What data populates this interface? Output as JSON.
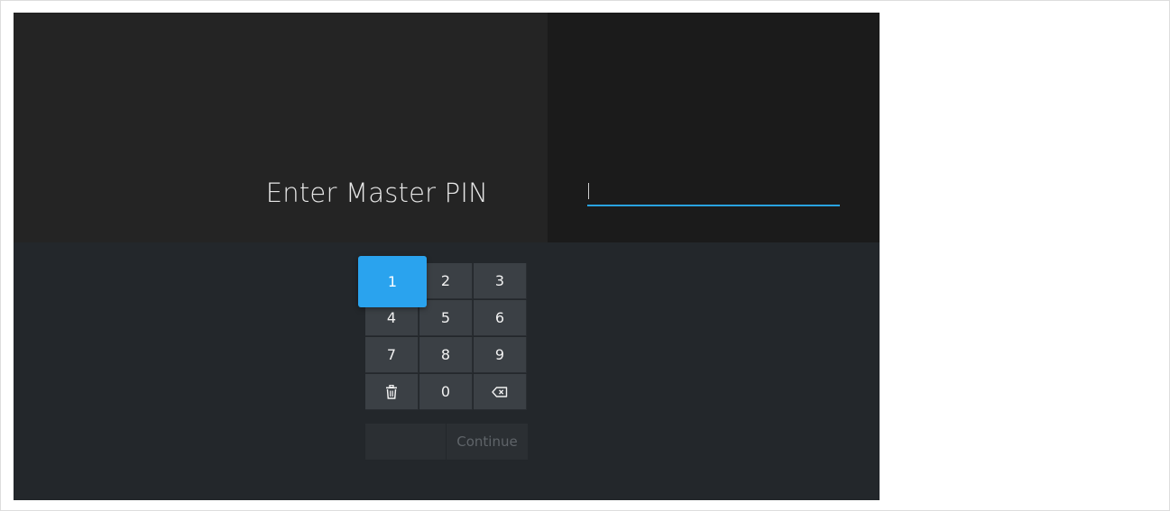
{
  "screen": {
    "title": "Enter Master PIN",
    "pin_value": "",
    "accent_color": "#2aa3ee"
  },
  "keypad": {
    "focused_key": "1",
    "keys": [
      {
        "label": "1"
      },
      {
        "label": "2"
      },
      {
        "label": "3"
      },
      {
        "label": "4"
      },
      {
        "label": "5"
      },
      {
        "label": "6"
      },
      {
        "label": "7"
      },
      {
        "label": "8"
      },
      {
        "label": "9"
      },
      {
        "icon": "trash-icon"
      },
      {
        "label": "0"
      },
      {
        "icon": "backspace-icon"
      }
    ]
  },
  "actions": {
    "blank_label": "",
    "continue_label": "Continue"
  }
}
